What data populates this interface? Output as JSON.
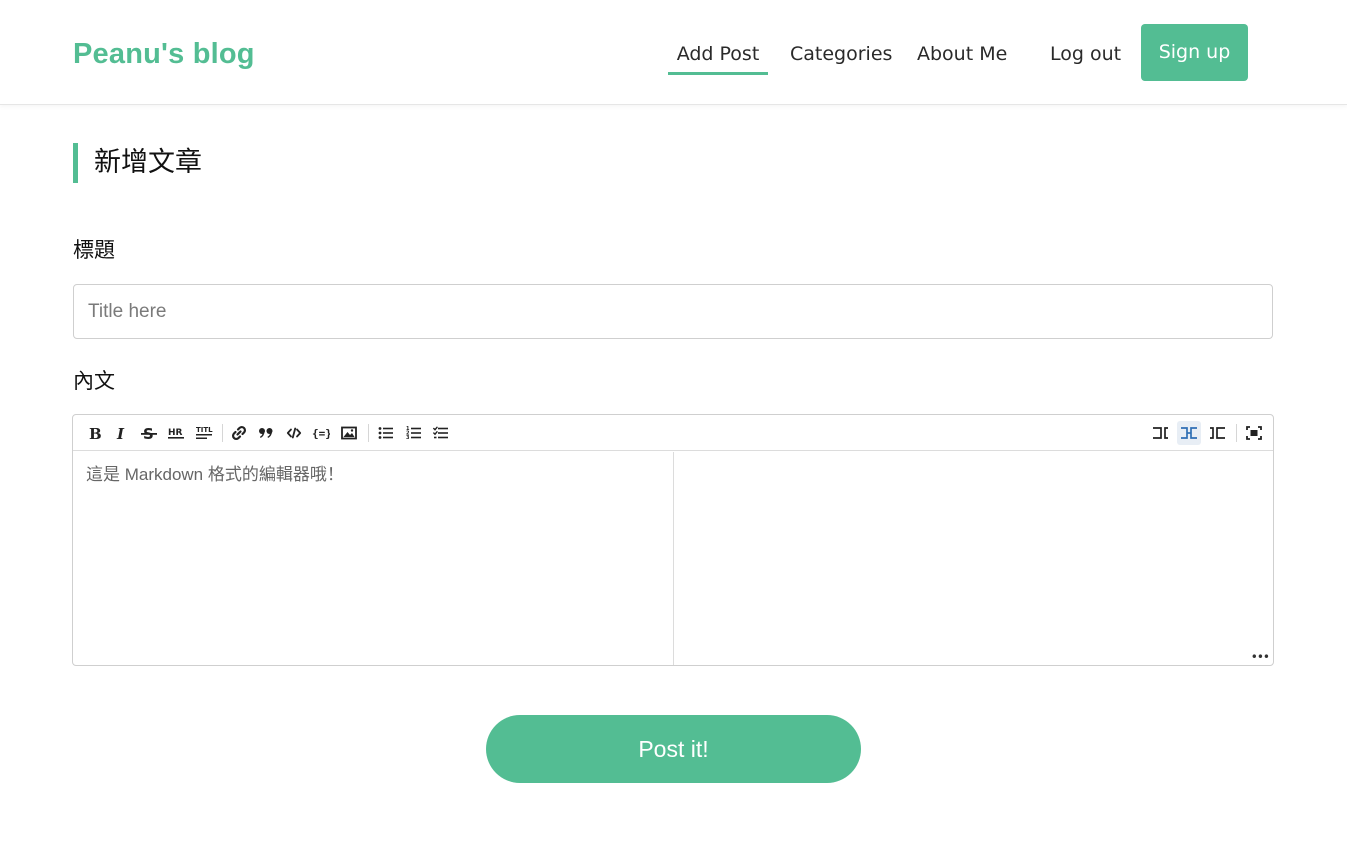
{
  "header": {
    "brand": "Peanu's blog",
    "nav": {
      "add_post": "Add Post",
      "categories": "Categories",
      "about_me": "About Me",
      "log_out": "Log out",
      "sign_up": "Sign up"
    },
    "active_nav": "add_post"
  },
  "page": {
    "title": "新增文章"
  },
  "form": {
    "title_label": "標題",
    "title_placeholder": "Title here",
    "title_value": "",
    "body_label": "內文",
    "body_placeholder": "這是 Markdown 格式的編輯器哦！",
    "submit_label": "Post it!"
  },
  "editor": {
    "toolbar_left": [
      "bold-icon",
      "italic-icon",
      "strikethrough-icon",
      "horizontal-rule-icon",
      "title-icon",
      "link-icon",
      "quote-icon",
      "code-icon",
      "code-block-icon",
      "image-icon",
      "unordered-list-icon",
      "ordered-list-icon",
      "checklist-icon"
    ],
    "toolbar_right": [
      "editor-only-icon",
      "split-view-icon",
      "preview-only-icon",
      "fullscreen-icon"
    ],
    "active_view": "split-view-icon"
  },
  "colors": {
    "accent": "#53bd93",
    "text": "#222222",
    "border": "#cfcfcf"
  }
}
